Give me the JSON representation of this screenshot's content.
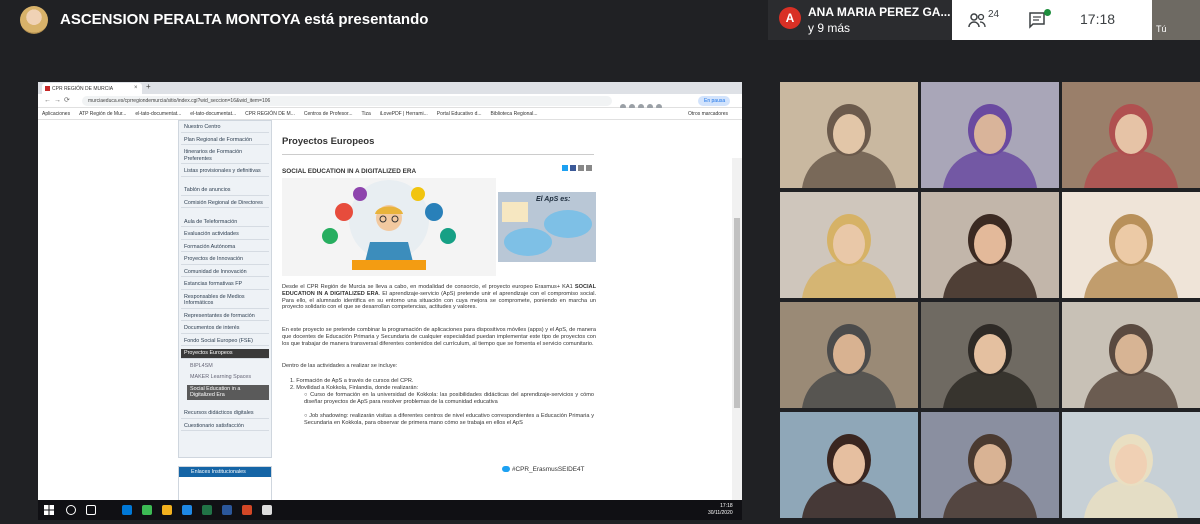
{
  "meet": {
    "presenter_banner": "ASCENSION PERALTA MONTOYA está presentando",
    "participant_initial": "A",
    "participant_name": "ANA MARIA PEREZ GA...",
    "participant_more": "y 9 más",
    "people_count": "24",
    "clock": "17:18",
    "self_label": "Tú"
  },
  "browser": {
    "tab_title": "CPR REGIÓN DE MURCIA",
    "tab_close": "×",
    "new_tab": "+",
    "url": "murciaeduca.es/cprregiondemurcia/sitio/index.cgi?wid_seccion=16&wid_item=106",
    "pause_label": "En pausa",
    "bookmarks": [
      "Aplicaciones",
      "ATP Región de Mur...",
      "el-tato-documentat...",
      "el-tato-documentat...",
      "CPR REGIÓN DE M...",
      "Centros de Profesor...",
      "Tiza",
      "iLovePDF | Herrami...",
      "Portal Educativo d...",
      "Biblioteca Regional...",
      "Otros marcadores"
    ]
  },
  "sidebar": {
    "items": [
      "Nuestro Centro",
      "Plan Regional de Formación",
      "Itinerarios de Formación Preferentes",
      "Listas provisionales y definitivas",
      "Tablón de anuncios",
      "Comisión Regional de Directores",
      "Aula de Teleformación",
      "Evaluación actividades",
      "Formación Autónoma",
      "Proyectos de Innovación",
      "Comunidad de Innovación",
      "Estancias formativas FP",
      "Responsables de Medios Informáticos",
      "Representantes de formación",
      "Documentos de interés",
      "Fondo Social Europeo (FSE)",
      "Proyectos Europeos"
    ],
    "subitems": [
      "BIPL4SM",
      "MAKER Learning Spaces",
      "Social Education in a Digitalized Era"
    ],
    "after_items": [
      "Recursos didácticos digitales",
      "Cuestionario satisfacción"
    ],
    "enlaces": "Enlaces Institucionales"
  },
  "content": {
    "title": "Proyectos Europeos",
    "subtitle": "SOCIAL EDUCATION IN A DIGITALIZED ERA",
    "aps_title": "El ApS es:",
    "p1_a": "Desde el CPR Región de Murcia se lleva a cabo, en modalidad de consorcio, el proyecto europeo Erasmus+ KA1",
    "p1_bold": "SOCIAL EDUCATION IN A DIGITALIZED ERA",
    "p1_b": ". El aprendizaje-servicio (ApS) pretende unir el aprendizaje con el compromiso social. Para ello, el alumnado identifica en su entorno una situación con cuya mejora se compromete, poniendo en marcha un proyecto solidario con el que se desarrollan competencias, actitudes y valores.",
    "p2": "En este proyecto se pretende combinar la programación de aplicaciones para dispositivos móviles (apps) y el ApS, de manera que docentes de Educación Primaria y Secundaria de cualquier especialidad puedan implementar este tipo de proyectos con los que trabajar de manera transversal diferentes contenidos del currículum, al tiempo que se fomenta el servicio comunitario.",
    "p3": "Dentro de las actividades a realizar se incluye:",
    "li1": "1. Formación de ApS a través de cursos del CPR.",
    "li2": "2. Movilidad a Kokkola, Finlandia, donde realizarán:",
    "b1": "○ Curso de formación en la universidad de Kokkola: las posibilidades didácticas del aprendizaje-servicios y cómo diseñar proyectos de ApS para resolver problemas de la comunidad educativa",
    "b2": "○ Job shadowing: realizarán visitas a diferentes centros de nivel educativo correspondientes a Educación Primaria y Secundaria en Kokkola, para observar de primera mano cómo se trabaja en ellos el ApS",
    "hashtag": "#CPR_ErasmusSEIDE4T"
  },
  "taskbar": {
    "time": "17:18",
    "date": "30/11/2020"
  },
  "colors": {
    "meet_bg": "#202124",
    "accent_red": "#d93025",
    "active_sidebar": "#3a3a3a",
    "twitter": "#1da1f2"
  }
}
